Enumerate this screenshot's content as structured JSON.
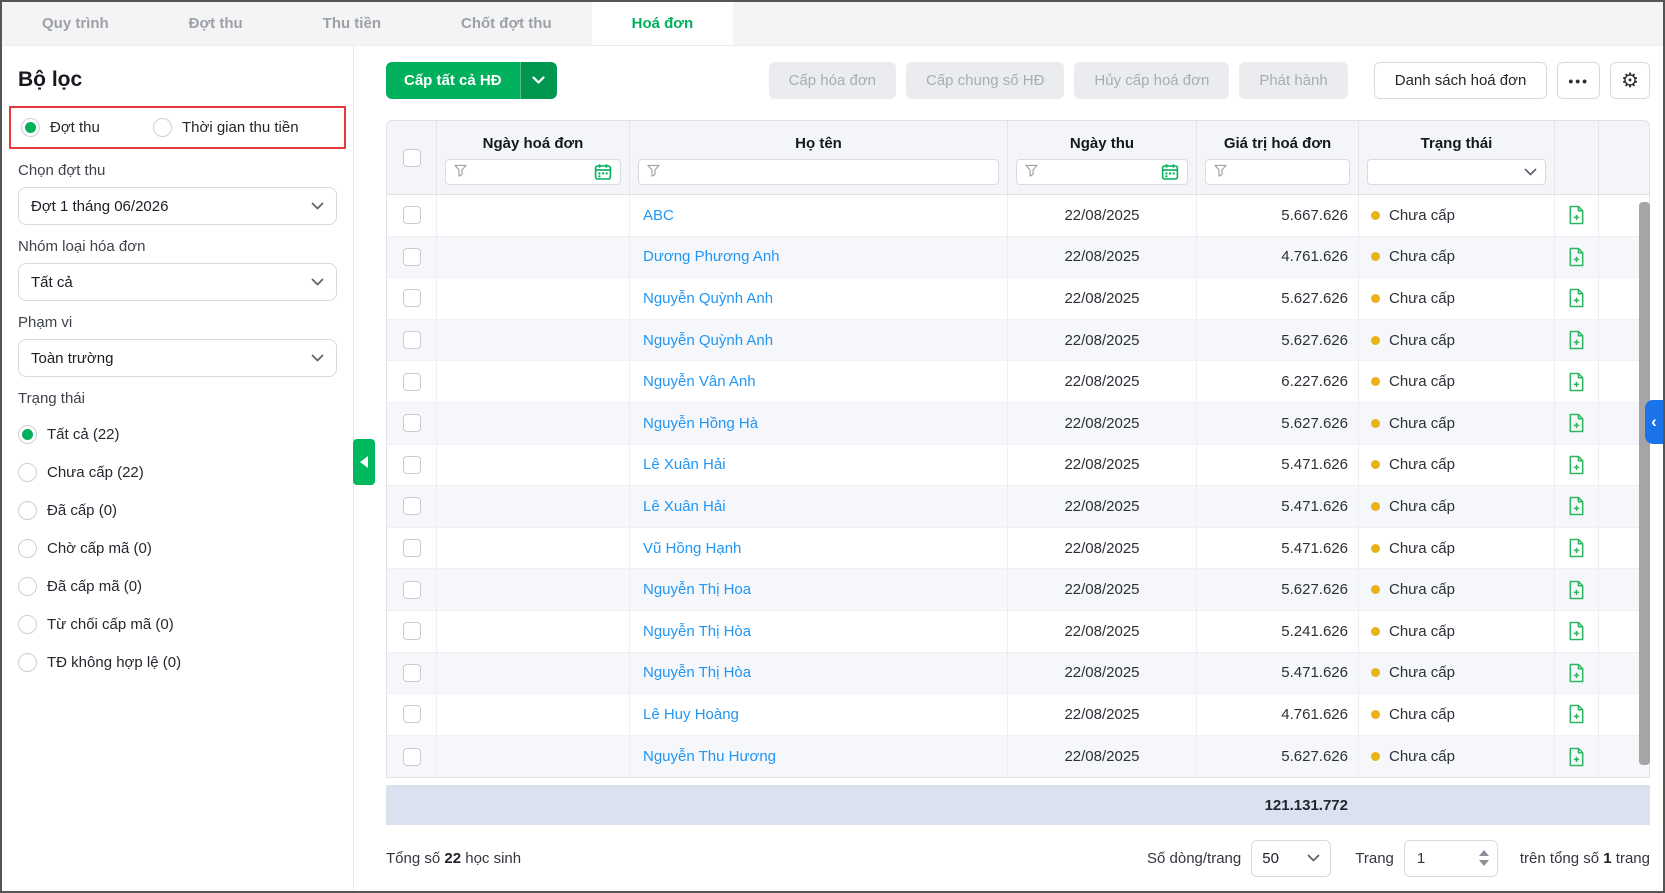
{
  "tabs": [
    {
      "label": "Quy trình",
      "active": false
    },
    {
      "label": "Đợt thu",
      "active": false
    },
    {
      "label": "Thu tiền",
      "active": false
    },
    {
      "label": "Chốt đợt thu",
      "active": false
    },
    {
      "label": "Hoá đơn",
      "active": true
    }
  ],
  "sidebar": {
    "title": "Bộ lọc",
    "mode_options": [
      {
        "label": "Đợt thu",
        "selected": true
      },
      {
        "label": "Thời gian thu tiền",
        "selected": false
      }
    ],
    "filters": [
      {
        "label": "Chọn đợt thu",
        "value": "Đợt 1 tháng 06/2026"
      },
      {
        "label": "Nhóm loại hóa đơn",
        "value": "Tất cả"
      },
      {
        "label": "Phạm vi",
        "value": "Toàn trường"
      }
    ],
    "status": {
      "label": "Trạng thái",
      "options": [
        {
          "label": "Tất cả (22)",
          "selected": true
        },
        {
          "label": "Chưa cấp (22)",
          "selected": false
        },
        {
          "label": "Đã cấp (0)",
          "selected": false
        },
        {
          "label": "Chờ cấp mã (0)",
          "selected": false
        },
        {
          "label": "Đã cấp mã (0)",
          "selected": false
        },
        {
          "label": "Từ chối cấp mã (0)",
          "selected": false
        },
        {
          "label": "TĐ không hợp lệ (0)",
          "selected": false
        }
      ]
    }
  },
  "toolbar": {
    "primary_label": "Cấp tất cả HĐ",
    "disabled_buttons": [
      "Cấp hóa đơn",
      "Cấp chung số HĐ",
      "Hủy cấp hoá đơn",
      "Phát hành"
    ],
    "list_button": "Danh sách hoá đơn",
    "more_button": "•••",
    "settings_icon": "gear-icon"
  },
  "table": {
    "columns": [
      "Ngày hoá đơn",
      "Họ tên",
      "Ngày thu",
      "Giá trị hoá đơn",
      "Trạng thái"
    ],
    "rows": [
      {
        "name": "ABC",
        "invoice_date": "",
        "collect_date": "22/08/2025",
        "amount": "5.667.626",
        "status": "Chưa cấp"
      },
      {
        "name": "Dương Phương Anh",
        "invoice_date": "",
        "collect_date": "22/08/2025",
        "amount": "4.761.626",
        "status": "Chưa cấp"
      },
      {
        "name": "Nguyễn Quỳnh Anh",
        "invoice_date": "",
        "collect_date": "22/08/2025",
        "amount": "5.627.626",
        "status": "Chưa cấp"
      },
      {
        "name": "Nguyễn Quỳnh Anh",
        "invoice_date": "",
        "collect_date": "22/08/2025",
        "amount": "5.627.626",
        "status": "Chưa cấp"
      },
      {
        "name": "Nguyễn Vân Anh",
        "invoice_date": "",
        "collect_date": "22/08/2025",
        "amount": "6.227.626",
        "status": "Chưa cấp"
      },
      {
        "name": "Nguyễn Hồng Hà",
        "invoice_date": "",
        "collect_date": "22/08/2025",
        "amount": "5.627.626",
        "status": "Chưa cấp"
      },
      {
        "name": "Lê Xuân Hải",
        "invoice_date": "",
        "collect_date": "22/08/2025",
        "amount": "5.471.626",
        "status": "Chưa cấp"
      },
      {
        "name": "Lê Xuân Hải",
        "invoice_date": "",
        "collect_date": "22/08/2025",
        "amount": "5.471.626",
        "status": "Chưa cấp"
      },
      {
        "name": "Vũ Hồng Hạnh",
        "invoice_date": "",
        "collect_date": "22/08/2025",
        "amount": "5.471.626",
        "status": "Chưa cấp"
      },
      {
        "name": "Nguyễn Thị Hoa",
        "invoice_date": "",
        "collect_date": "22/08/2025",
        "amount": "5.627.626",
        "status": "Chưa cấp"
      },
      {
        "name": "Nguyễn Thị Hòa",
        "invoice_date": "",
        "collect_date": "22/08/2025",
        "amount": "5.241.626",
        "status": "Chưa cấp"
      },
      {
        "name": "Nguyễn Thị Hòa",
        "invoice_date": "",
        "collect_date": "22/08/2025",
        "amount": "5.471.626",
        "status": "Chưa cấp"
      },
      {
        "name": "Lê Huy Hoàng",
        "invoice_date": "",
        "collect_date": "22/08/2025",
        "amount": "4.761.626",
        "status": "Chưa cấp"
      },
      {
        "name": "Nguyễn Thu Hương",
        "invoice_date": "",
        "collect_date": "22/08/2025",
        "amount": "5.627.626",
        "status": "Chưa cấp"
      }
    ],
    "summary_total": "121.131.772"
  },
  "footer": {
    "total_prefix": "Tổng số",
    "total_count": "22",
    "total_suffix": "học sinh",
    "rows_per_page_label": "Số dòng/trang",
    "rows_per_page_value": "50",
    "page_label": "Trang",
    "page_value": "1",
    "total_pages_prefix": "trên tổng số",
    "total_pages": "1",
    "total_pages_suffix": "trang"
  },
  "icons": {
    "filter": "funnel-icon",
    "calendar": "calendar-icon",
    "settings": "gear-icon",
    "more": "ellipsis-icon",
    "row_action": "file-plus-icon",
    "collapse_sidebar": "triangle-left-icon",
    "expand_right_panel": "chevron-left-icon"
  },
  "colors": {
    "accent_green": "#00b05c",
    "accent_green_dark": "#009850",
    "link_blue": "#2196f3",
    "status_yellow": "#e9b215",
    "highlight_red": "#e5393c",
    "summary_bg": "#dae1ef",
    "panel_handle_blue": "#1a73e8"
  }
}
